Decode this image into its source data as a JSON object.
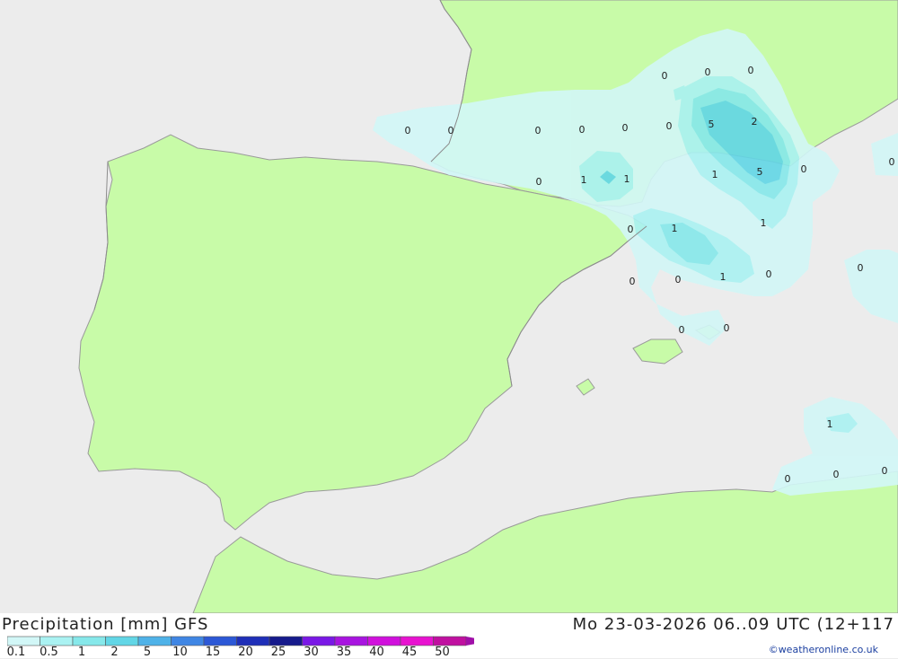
{
  "header": {
    "title": "Precipitation [mm] GFS",
    "datetime": "Mo 23-03-2026 06..09 UTC (12+117",
    "credit": "©weatheronline.co.uk"
  },
  "legend": {
    "ticks": [
      "0.1",
      "0.5",
      "1",
      "2",
      "5",
      "10",
      "15",
      "20",
      "25",
      "30",
      "35",
      "40",
      "45",
      "50"
    ],
    "colors": [
      "#d2f7f7",
      "#aaf2f2",
      "#86e8ea",
      "#62d6e6",
      "#4fb2e8",
      "#3f86e4",
      "#2c58d6",
      "#1f2fb8",
      "#161a8c",
      "#7a18e6",
      "#a814e0",
      "#d010dc",
      "#e812d0",
      "#c010a0"
    ]
  },
  "map": {
    "land_color": "#c8fba8",
    "sea_color": "#ececec",
    "labels": [
      "0",
      "0",
      "0",
      "0",
      "1",
      "0",
      "0",
      "5",
      "2",
      "0",
      "1",
      "1",
      "1",
      "5",
      "0",
      "0",
      "1",
      "1",
      "0",
      "0",
      "0",
      "1",
      "0",
      "0",
      "0",
      "0",
      "1",
      "0",
      "0",
      "0"
    ]
  }
}
